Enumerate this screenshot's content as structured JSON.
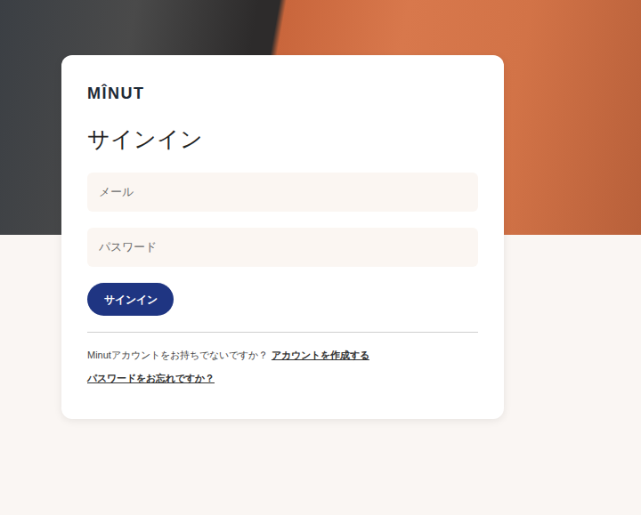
{
  "logo": {
    "text": "MÎNUT"
  },
  "title": "サインイン",
  "fields": [
    {
      "placeholder": "メール",
      "kind": "email"
    },
    {
      "placeholder": "パスワード",
      "kind": "password"
    }
  ],
  "submit_button": "サインイン",
  "signup": {
    "prompt": "Minutアカウントをお持ちでないですか？",
    "link": "アカウントを作成する"
  },
  "forgot_link": "パスワードをお忘れですか？"
}
